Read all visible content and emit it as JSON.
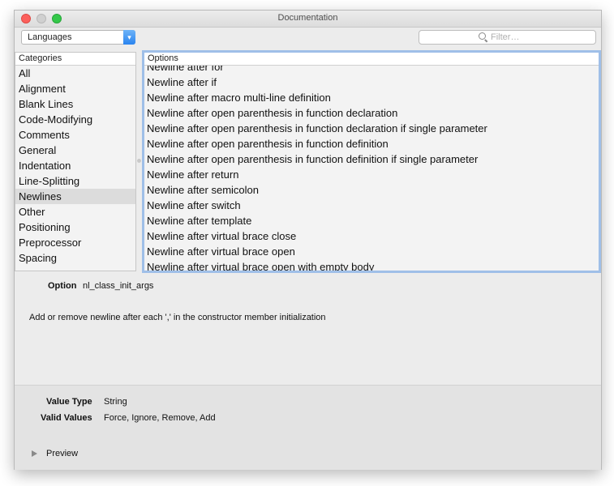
{
  "window": {
    "title": "Documentation"
  },
  "toolbar": {
    "language_label": "Languages",
    "filter_placeholder": "Filter…"
  },
  "categories": {
    "header": "Categories",
    "items": [
      {
        "label": "All",
        "selected": false
      },
      {
        "label": "Alignment",
        "selected": false
      },
      {
        "label": "Blank Lines",
        "selected": false
      },
      {
        "label": "Code-Modifying",
        "selected": false
      },
      {
        "label": "Comments",
        "selected": false
      },
      {
        "label": "General",
        "selected": false
      },
      {
        "label": "Indentation",
        "selected": false
      },
      {
        "label": "Line-Splitting",
        "selected": false
      },
      {
        "label": "Newlines",
        "selected": true
      },
      {
        "label": "Other",
        "selected": false
      },
      {
        "label": "Positioning",
        "selected": false
      },
      {
        "label": "Preprocessor",
        "selected": false
      },
      {
        "label": "Spacing",
        "selected": false
      }
    ]
  },
  "options": {
    "header": "Options",
    "items": [
      "Newline after for",
      "Newline after if",
      "Newline after macro multi-line definition",
      "Newline after open parenthesis in function declaration",
      "Newline after open parenthesis in function declaration if single parameter",
      "Newline after open parenthesis in function definition",
      "Newline after open parenthesis in function definition if single parameter",
      "Newline after return",
      "Newline after semicolon",
      "Newline after switch",
      "Newline after template",
      "Newline after virtual brace close",
      "Newline after virtual brace open",
      "Newline after virtual brace open with empty body"
    ]
  },
  "detail": {
    "option_label": "Option",
    "option_name": "nl_class_init_args",
    "description": "Add or remove newline after each ',' in the constructor member initialization"
  },
  "meta": {
    "value_type_label": "Value Type",
    "value_type": "String",
    "valid_values_label": "Valid Values",
    "valid_values": "Force, Ignore, Remove, Add",
    "preview_label": "Preview"
  },
  "colors": {
    "accent": "#2a84ef",
    "focus_ring": "#9fbfe8",
    "close": "#fc605c",
    "zoom": "#34c84a"
  }
}
